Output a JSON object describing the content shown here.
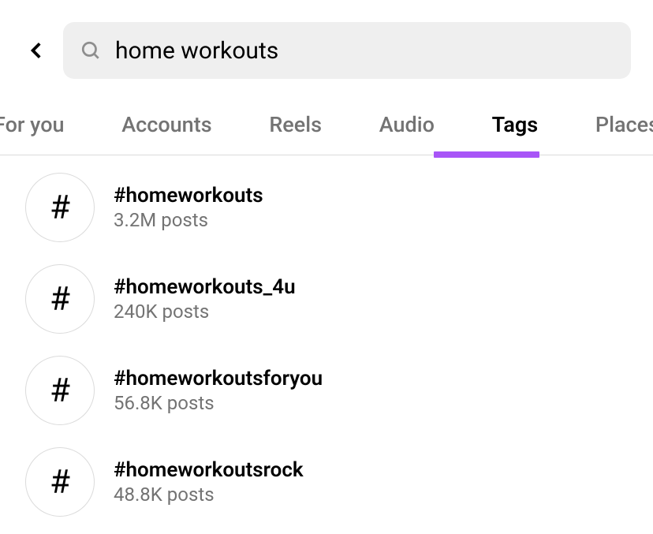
{
  "search": {
    "query": "home workouts"
  },
  "tabs": [
    {
      "label": "For you",
      "active": false
    },
    {
      "label": "Accounts",
      "active": false
    },
    {
      "label": "Reels",
      "active": false
    },
    {
      "label": "Audio",
      "active": false
    },
    {
      "label": "Tags",
      "active": true
    },
    {
      "label": "Places",
      "active": false
    }
  ],
  "results": [
    {
      "name": "#homeworkouts",
      "count": "3.2M posts"
    },
    {
      "name": "#homeworkouts_4u",
      "count": "240K posts"
    },
    {
      "name": "#homeworkoutsforyou",
      "count": "56.8K posts"
    },
    {
      "name": "#homeworkoutsrock",
      "count": "48.8K posts"
    }
  ]
}
